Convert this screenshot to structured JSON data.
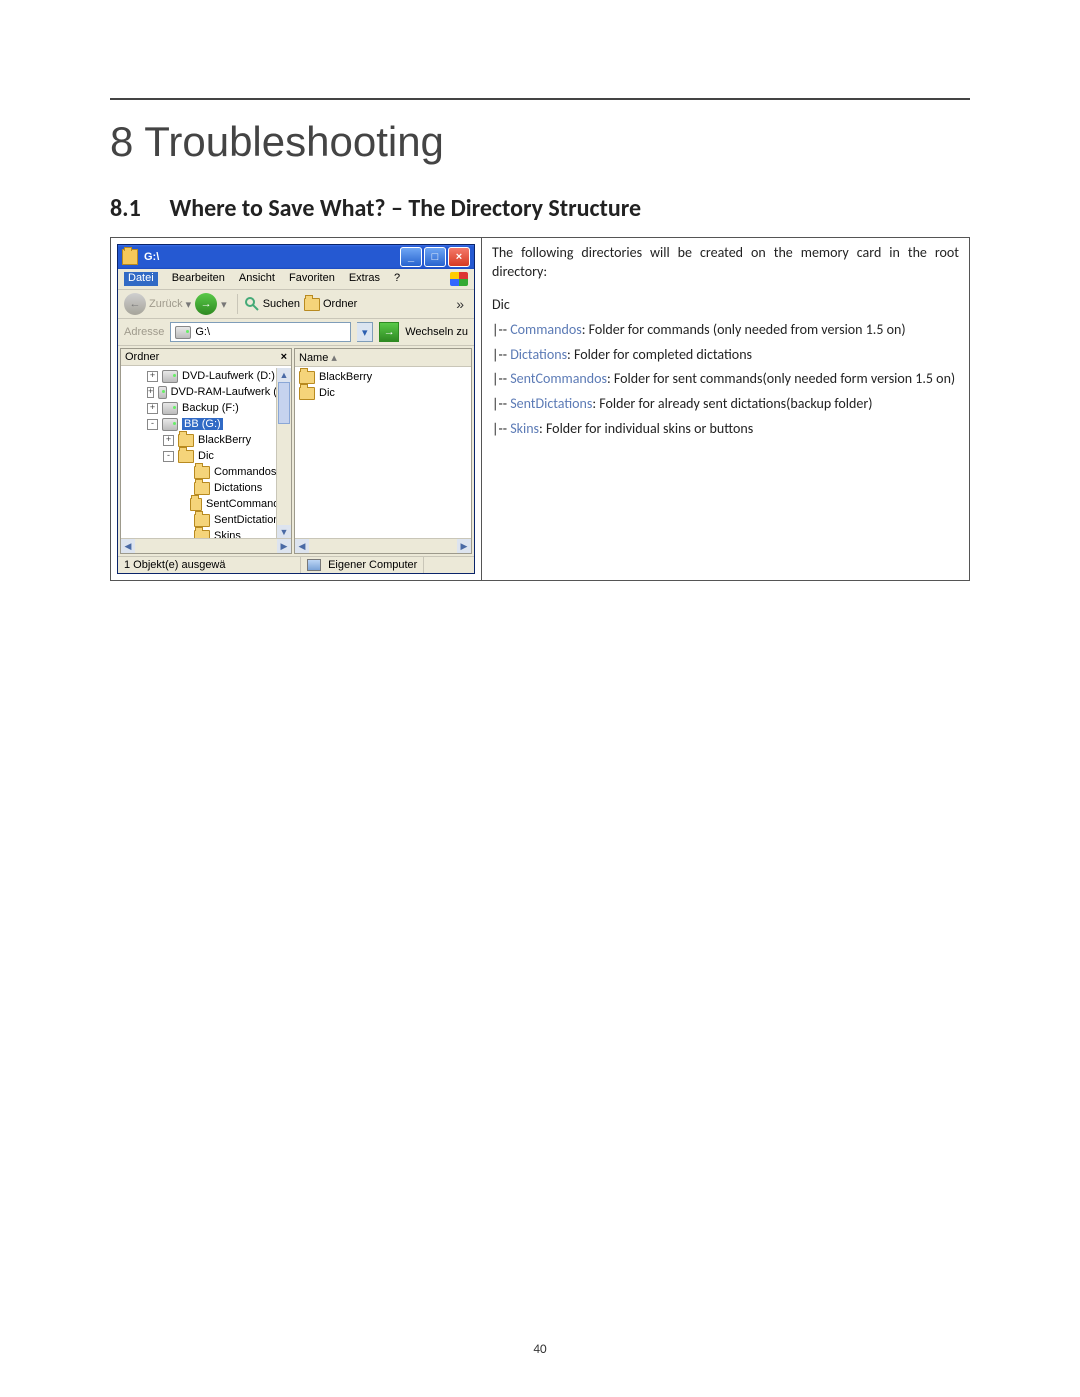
{
  "page_number": "40",
  "chapter_title": "8 Troubleshooting",
  "section_number": "8.1",
  "section_title": "Where to Save What? – The Directory Structure",
  "desc": {
    "intro": "The following directories will be created on the memory card in the root directory:",
    "root": "Dic",
    "items": [
      {
        "prefix": "|-- ",
        "name": "Commandos",
        "rest": ": Folder for commands (only needed from version 1.5 on)"
      },
      {
        "prefix": "|-- ",
        "name": "Dictations",
        "rest": ": Folder for completed dictations"
      },
      {
        "prefix": "|-- ",
        "name": "SentCommandos",
        "rest": ": Folder for sent commands(only needed form version 1.5 on)"
      },
      {
        "prefix": "|-- ",
        "name": "SentDictations",
        "rest": ": Folder for already sent dictations(backup folder)"
      },
      {
        "prefix": "|-- ",
        "name": "Skins",
        "rest": ": Folder for individual skins or buttons"
      }
    ]
  },
  "explorer": {
    "title": "G:\\",
    "menus": [
      "Datei",
      "Bearbeiten",
      "Ansicht",
      "Favoriten",
      "Extras",
      "?"
    ],
    "toolbar": {
      "back": "Zurück",
      "search": "Suchen",
      "folders": "Ordner"
    },
    "address_label": "Adresse",
    "address_value": "G:\\",
    "go_label": "Wechseln zu",
    "tree_header": "Ordner",
    "list_header": "Name",
    "tree": [
      {
        "indent": 18,
        "pm": "+",
        "icon": "drv",
        "label": "DVD-Laufwerk (D:)"
      },
      {
        "indent": 18,
        "pm": "+",
        "icon": "drv",
        "label": "DVD-RAM-Laufwerk (E:)"
      },
      {
        "indent": 18,
        "pm": "+",
        "icon": "drv",
        "label": "Backup (F:)"
      },
      {
        "indent": 18,
        "pm": "-",
        "icon": "drv",
        "label": "BB (G:)",
        "selected": true
      },
      {
        "indent": 34,
        "pm": "+",
        "icon": "fld",
        "label": "BlackBerry"
      },
      {
        "indent": 34,
        "pm": "-",
        "icon": "fld",
        "label": "Dic"
      },
      {
        "indent": 50,
        "pm": "",
        "icon": "fld",
        "label": "Commandos"
      },
      {
        "indent": 50,
        "pm": "",
        "icon": "fld",
        "label": "Dictations"
      },
      {
        "indent": 50,
        "pm": "",
        "icon": "fld",
        "label": "SentCommandos"
      },
      {
        "indent": 50,
        "pm": "",
        "icon": "fld",
        "label": "SentDictations"
      },
      {
        "indent": 50,
        "pm": "",
        "icon": "fld",
        "label": "Skins"
      }
    ],
    "list": [
      {
        "icon": "fld",
        "label": "BlackBerry"
      },
      {
        "icon": "fld",
        "label": "Dic"
      }
    ],
    "status_left": "1 Objekt(e) ausgewä",
    "status_right": "Eigener Computer"
  }
}
